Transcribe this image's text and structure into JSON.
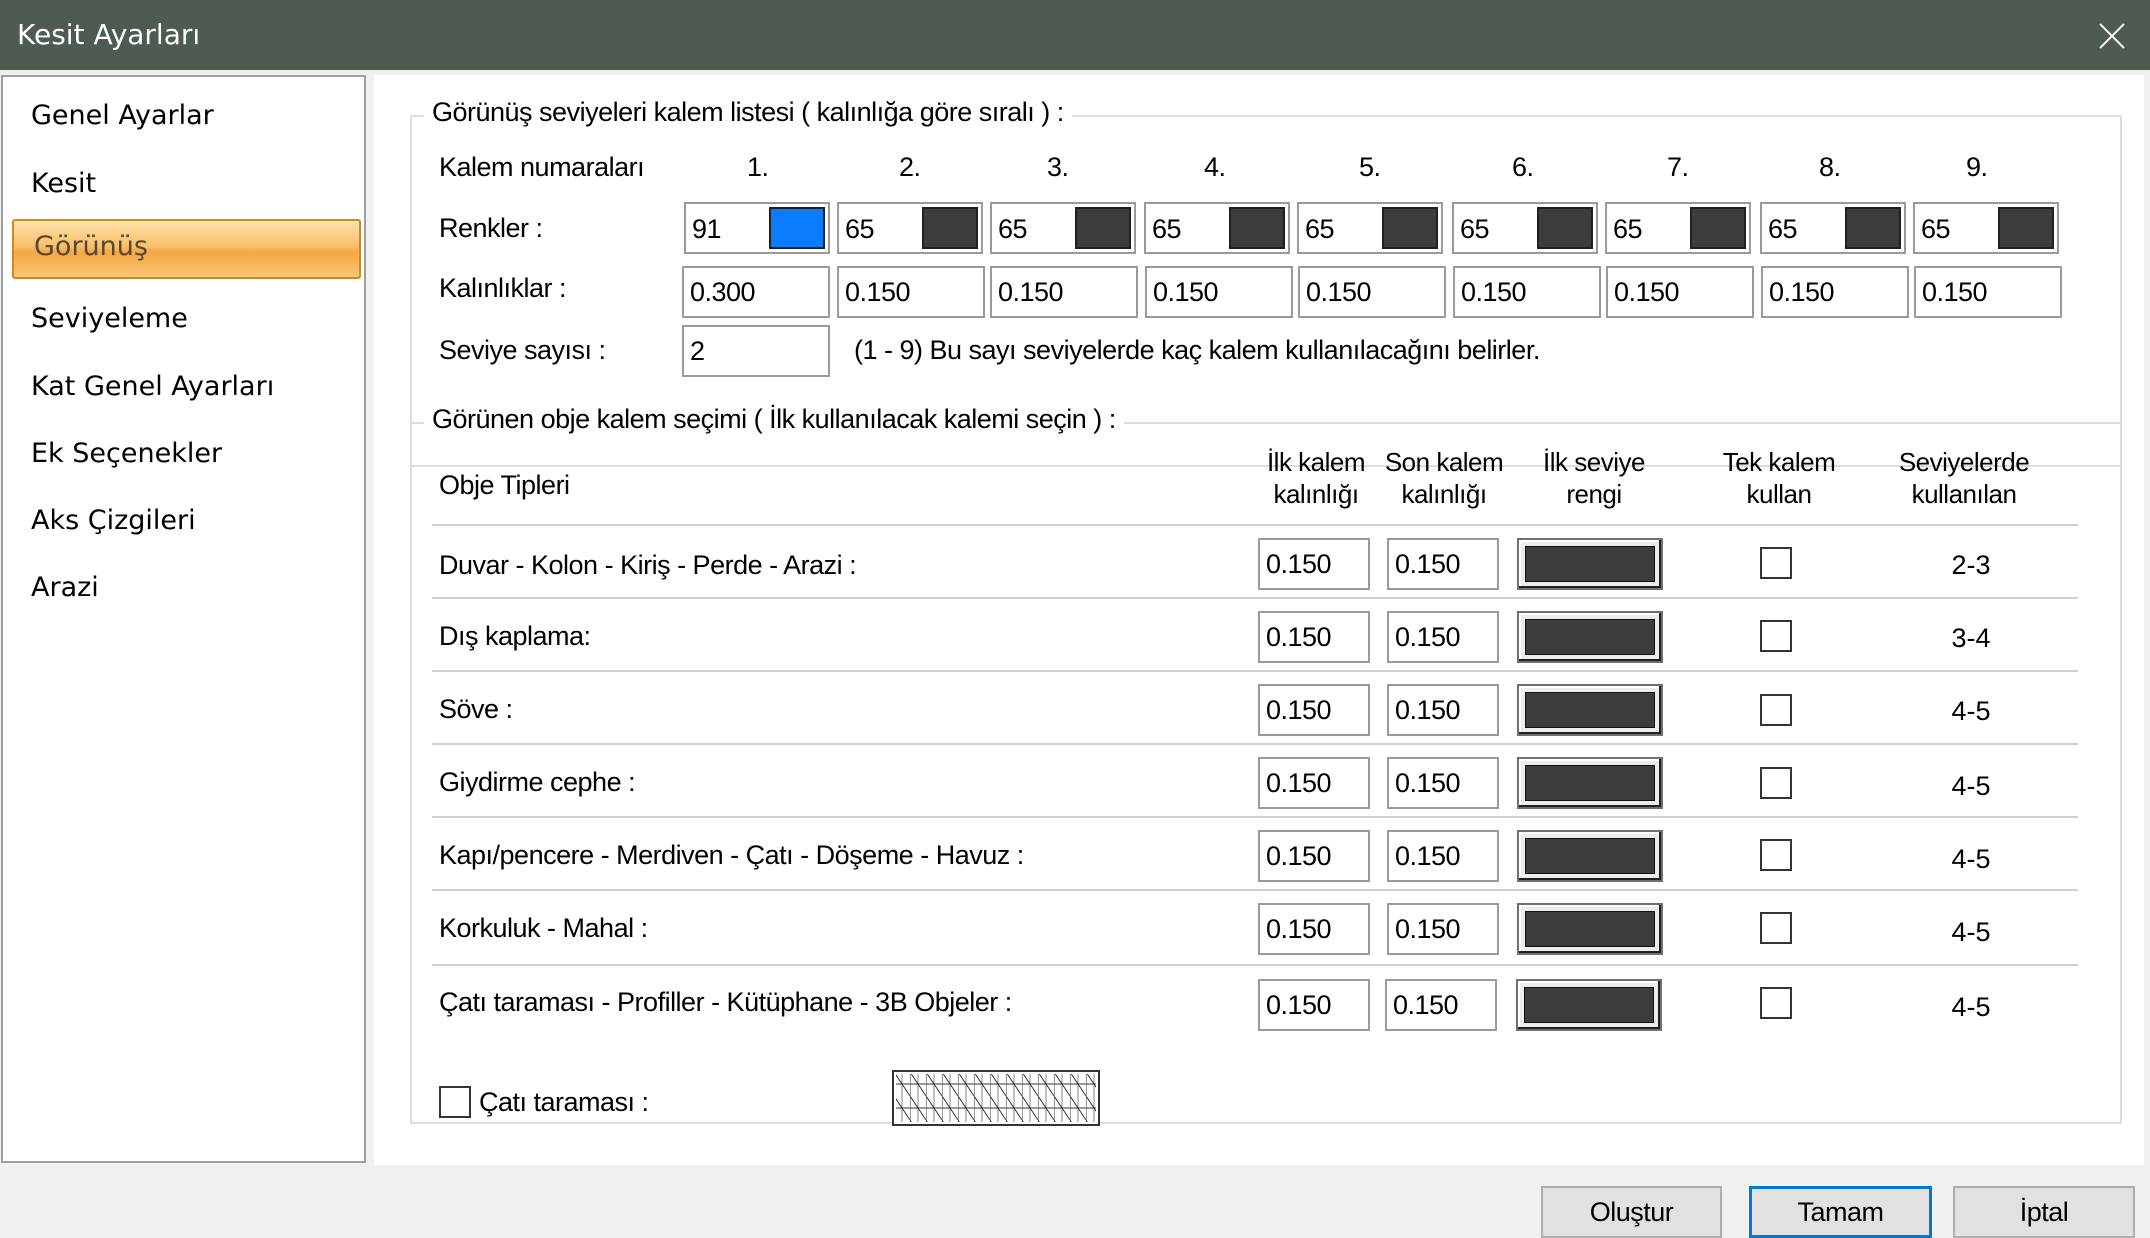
{
  "window": {
    "title": "Kesit Ayarları"
  },
  "sidebar": {
    "items": [
      {
        "label": "Genel Ayarlar"
      },
      {
        "label": "Kesit"
      },
      {
        "label": "Görünüş",
        "selected": true
      },
      {
        "label": "Seviyeleme"
      },
      {
        "label": "Kat Genel Ayarları"
      },
      {
        "label": "Ek Seçenekler"
      },
      {
        "label": "Aks Çizgileri"
      },
      {
        "label": "Arazi"
      }
    ]
  },
  "pens": {
    "legend": "Görünüş seviyeleri kalem listesi ( kalınlığa göre sıralı ) :",
    "numbers_label": "Kalem numaraları",
    "numbers": [
      "1.",
      "2.",
      "3.",
      "4.",
      "5.",
      "6.",
      "7.",
      "8.",
      "9."
    ],
    "colors_label": "Renkler :",
    "colors": [
      {
        "value": "91",
        "swatch": "#0a7cff"
      },
      {
        "value": "65",
        "swatch": "#3c3c3c"
      },
      {
        "value": "65",
        "swatch": "#3c3c3c"
      },
      {
        "value": "65",
        "swatch": "#3c3c3c"
      },
      {
        "value": "65",
        "swatch": "#3c3c3c"
      },
      {
        "value": "65",
        "swatch": "#3c3c3c"
      },
      {
        "value": "65",
        "swatch": "#3c3c3c"
      },
      {
        "value": "65",
        "swatch": "#3c3c3c"
      },
      {
        "value": "65",
        "swatch": "#3c3c3c"
      }
    ],
    "thickness_label": "Kalınlıklar :",
    "thicknesses": [
      "0.300",
      "0.150",
      "0.150",
      "0.150",
      "0.150",
      "0.150",
      "0.150",
      "0.150",
      "0.150"
    ],
    "level_count_label": "Seviye sayısı :",
    "level_count": "2",
    "level_count_hint": "(1 - 9) Bu sayı seviyelerde kaç kalem kullanılacağını belirler."
  },
  "objects": {
    "legend": "Görünen obje kalem seçimi ( İlk kullanılacak kalemi seçin ) :",
    "headers": {
      "types": "Obje Tipleri",
      "first_1": "İlk kalem",
      "first_2": "kalınlığı",
      "last_1": "Son kalem",
      "last_2": "kalınlığı",
      "color_1": "İlk seviye",
      "color_2": "rengi",
      "single_1": "Tek kalem",
      "single_2": "kullan",
      "levels_1": "Seviyelerde",
      "levels_2": "kullanılan"
    },
    "rows": [
      {
        "label": "Duvar - Kolon - Kiriş - Perde - Arazi :",
        "first": "0.150",
        "last": "0.150",
        "color": "#3c3c3c",
        "single": false,
        "levels": "2-3"
      },
      {
        "label": "Dış kaplama:",
        "first": "0.150",
        "last": "0.150",
        "color": "#3c3c3c",
        "single": false,
        "levels": "3-4"
      },
      {
        "label": "Söve :",
        "first": "0.150",
        "last": "0.150",
        "color": "#3c3c3c",
        "single": false,
        "levels": "4-5"
      },
      {
        "label": "Giydirme cephe :",
        "first": "0.150",
        "last": "0.150",
        "color": "#3c3c3c",
        "single": false,
        "levels": "4-5"
      },
      {
        "label": "Kapı/pencere - Merdiven - Çatı - Döşeme - Havuz :",
        "first": "0.150",
        "last": "0.150",
        "color": "#3c3c3c",
        "single": false,
        "levels": "4-5"
      },
      {
        "label": "Korkuluk - Mahal :",
        "first": "0.150",
        "last": "0.150",
        "color": "#3c3c3c",
        "single": false,
        "levels": "4-5"
      },
      {
        "label": "Çatı taraması - Profiller - Kütüphane - 3B Objeler :",
        "first": "0.150",
        "last": "0.150",
        "color": "#3c3c3c",
        "single": false,
        "levels": "4-5"
      }
    ]
  },
  "roof_hatch": {
    "label": "Çatı taraması :",
    "checked": false
  },
  "footer": {
    "create": "Oluştur",
    "ok": "Tamam",
    "cancel": "İptal"
  }
}
